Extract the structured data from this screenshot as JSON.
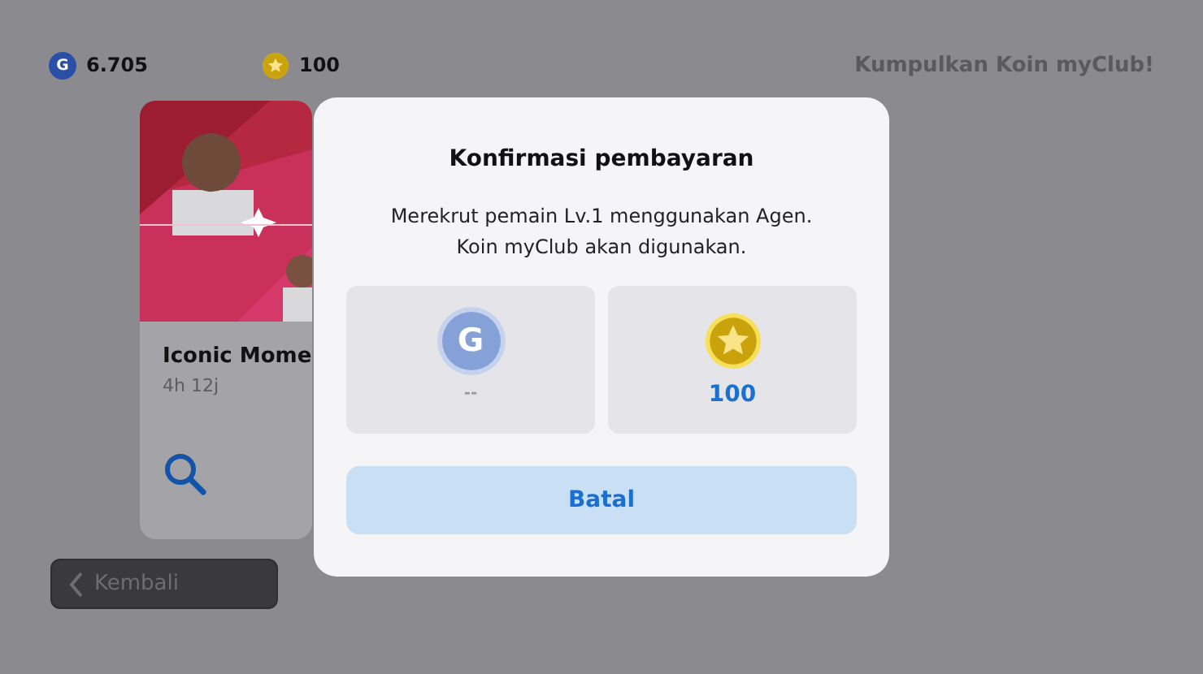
{
  "balances": [
    {
      "kind": "gp",
      "icon_letter": "G",
      "amount": "6.705"
    },
    {
      "kind": "coin",
      "amount": "100"
    }
  ],
  "promo": "Kumpulkan Koin myClub!",
  "card": {
    "kind": "picture",
    "title": "Iconic Mome",
    "time": "4h 12j"
  },
  "back_button": {
    "label": "Kembali"
  },
  "dialog": {
    "title": "Konfirmasi pembayaran",
    "message": "Merekrut pemain Lv.1 menggunakan Agen.\nKoin myClub akan digunakan.",
    "options": [
      {
        "kind": "gp",
        "icon_letter": "G",
        "amount": "--",
        "disabled": true
      },
      {
        "kind": "coin",
        "amount": "100",
        "disabled": false
      }
    ],
    "cancel_button": "Batal"
  }
}
